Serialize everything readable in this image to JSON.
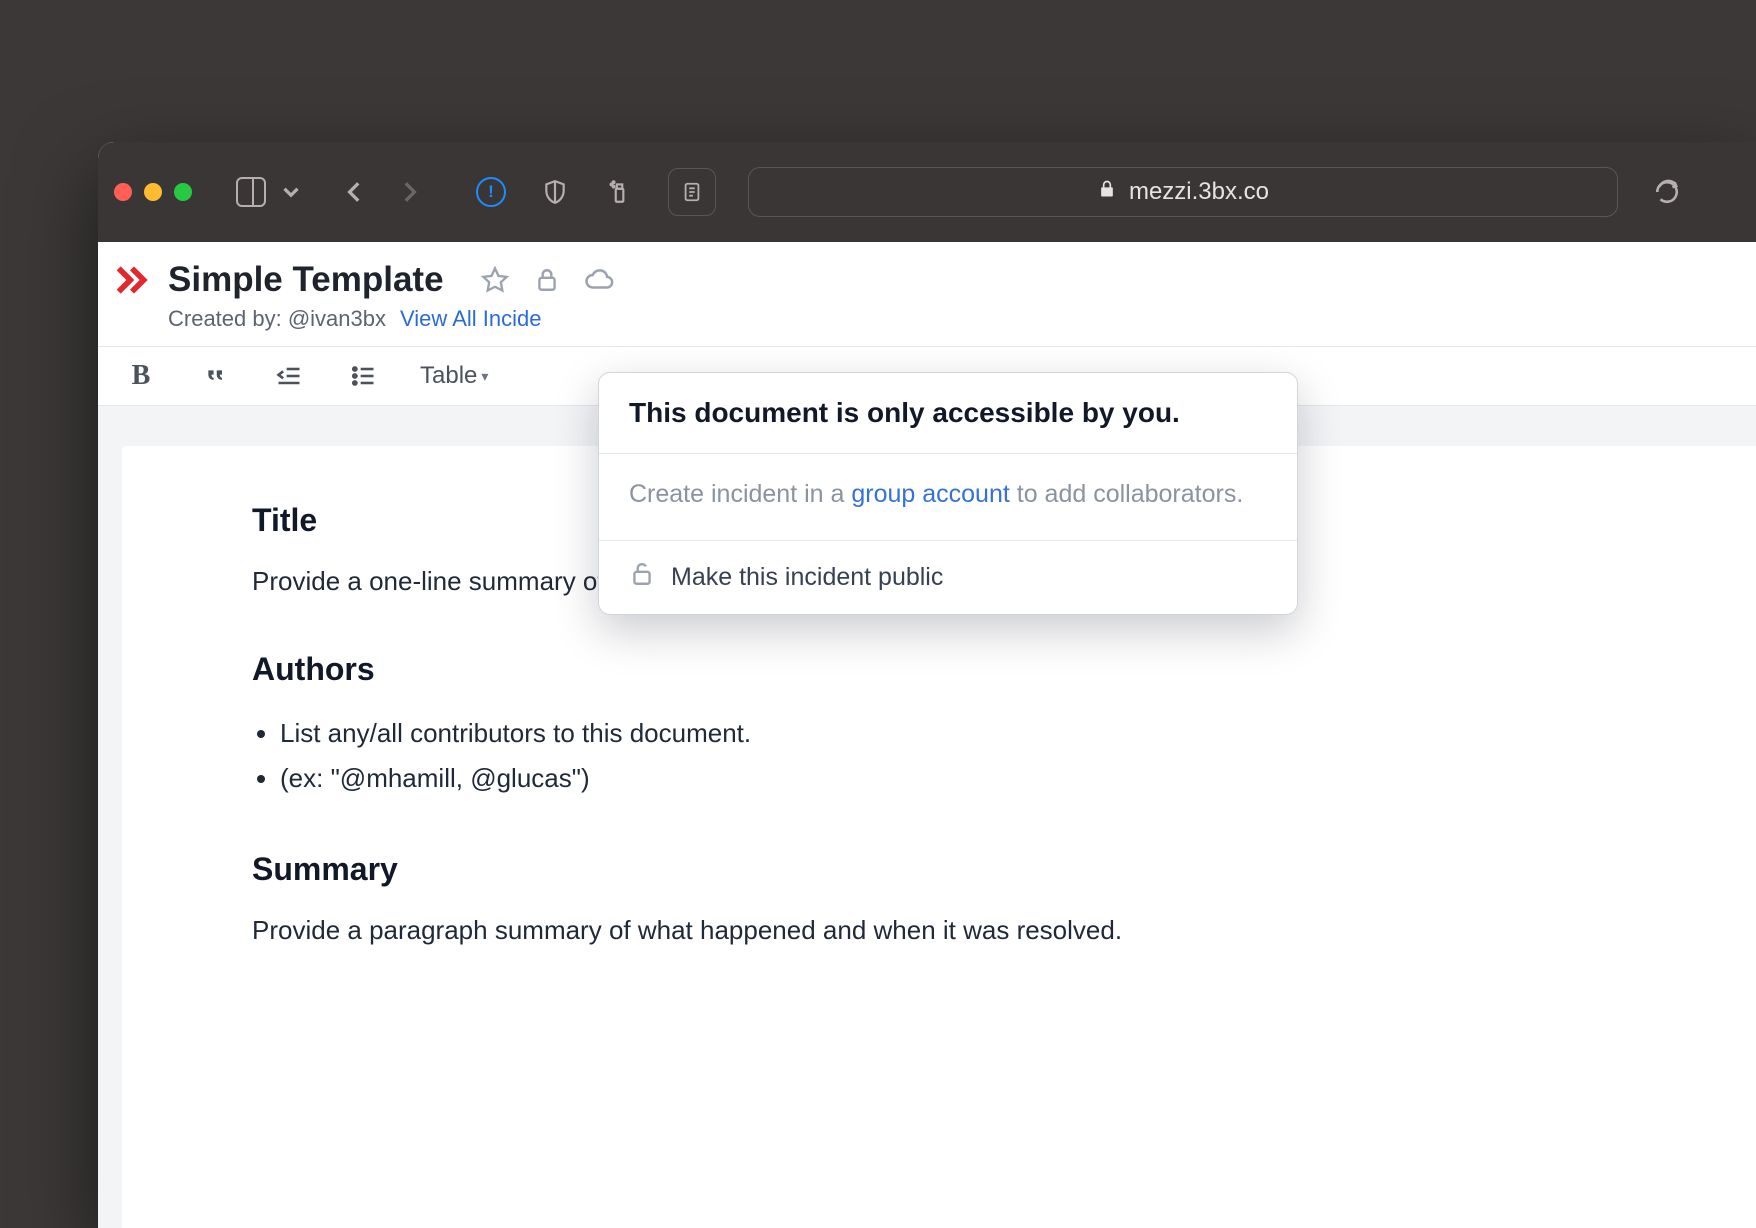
{
  "browser": {
    "url": "mezzi.3bx.co"
  },
  "page": {
    "title": "Simple Template",
    "created_by_label": "Created by: @ivan3bx",
    "view_all_link": "View All Incide"
  },
  "toolbar": {
    "table_label": "Table"
  },
  "popover": {
    "heading": "This document is only accessible by you.",
    "body_prefix": "Create incident in a ",
    "body_link": "group account",
    "body_suffix": " to add collaborators.",
    "action_label": "Make this incident public"
  },
  "document": {
    "sections": [
      {
        "heading": "Title",
        "paragraph": "Provide a one-line summary of the incident."
      },
      {
        "heading": "Authors",
        "bullets": [
          "List any/all contributors to this document.",
          "(ex: \"@mhamill, @glucas\")"
        ]
      },
      {
        "heading": "Summary",
        "paragraph": "Provide a paragraph summary of what happened and when it was resolved."
      }
    ]
  }
}
